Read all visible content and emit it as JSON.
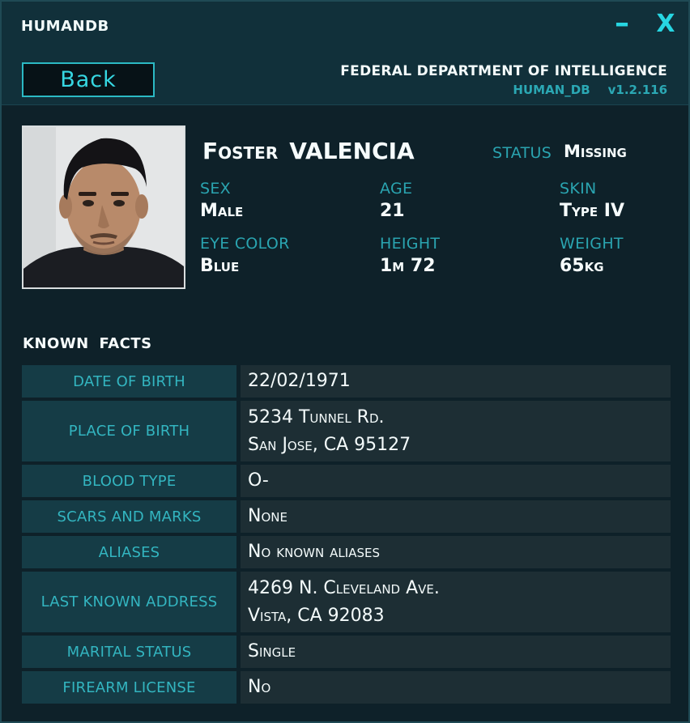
{
  "window": {
    "title": "HUMANDB",
    "minimize_glyph": "–",
    "close_glyph": "X"
  },
  "header": {
    "back_label": "Back",
    "agency": "FEDERAL DEPARTMENT OF INTELLIGENCE",
    "db_name": "HUMAN_DB",
    "version": "v1.2.116"
  },
  "profile": {
    "first_name": "Foster",
    "last_name": "VALENCIA",
    "status_label": "STATUS",
    "status_value": "Missing",
    "attributes": [
      {
        "label": "SEX",
        "value": "Male"
      },
      {
        "label": "AGE",
        "value": "21"
      },
      {
        "label": "SKIN",
        "value": "Type IV"
      },
      {
        "label": "EYE COLOR",
        "value": "Blue"
      },
      {
        "label": "HEIGHT",
        "value": "1m 72"
      },
      {
        "label": "WEIGHT",
        "value": "65kg"
      }
    ]
  },
  "facts": {
    "heading": "KNOWN FACTS",
    "rows": [
      {
        "key": "DATE OF BIRTH",
        "lines": [
          "22/02/1971"
        ]
      },
      {
        "key": "PLACE OF BIRTH",
        "lines": [
          "5234 Tunnel Rd.",
          "San Jose, CA 95127"
        ]
      },
      {
        "key": "BLOOD TYPE",
        "lines": [
          "O-"
        ]
      },
      {
        "key": "SCARS AND MARKS",
        "lines": [
          "None"
        ]
      },
      {
        "key": "ALIASES",
        "lines": [
          "No known aliases"
        ]
      },
      {
        "key": "LAST KNOWN ADDRESS",
        "lines": [
          "4269 N. Cleveland Ave.",
          "Vista, CA 92083"
        ]
      },
      {
        "key": "MARITAL STATUS",
        "lines": [
          "Single"
        ]
      },
      {
        "key": "FIREARM LICENSE",
        "lines": [
          "No"
        ]
      }
    ]
  },
  "colors": {
    "accent": "#2aa4b0",
    "window_bg": "#0e2129",
    "key_cell": "#153c46",
    "value_cell": "#1d2e34"
  },
  "icons": {
    "minimize": "minimize-icon",
    "close": "close-icon"
  }
}
